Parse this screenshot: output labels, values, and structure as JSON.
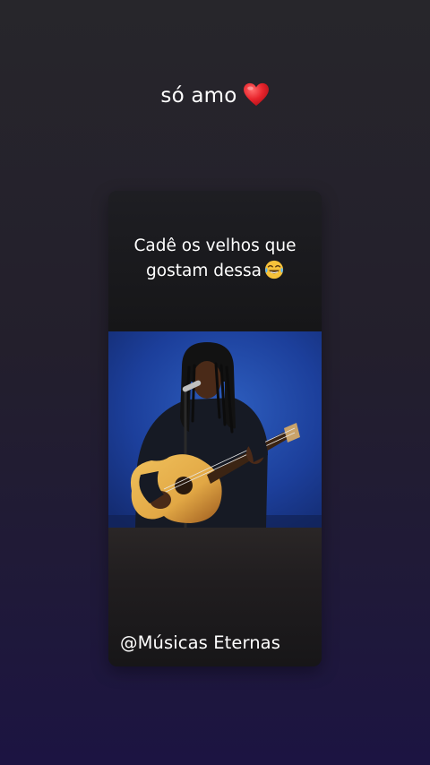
{
  "story": {
    "caption": "só amo",
    "caption_emoji": "red-heart-icon",
    "colors": {
      "background_top": "#27262b",
      "background_bottom": "#1c1442",
      "heart": "#e8242c"
    }
  },
  "post": {
    "question_line1": "Cadê os velhos que",
    "question_line2": "gostam dessa",
    "question_emoji": "tears-of-joy-icon",
    "video_description_icon": "guitarist-performance-thumbnail",
    "watermark": "@Músicas Eternas",
    "colors": {
      "video_background": "#1c3f9b",
      "guitar_body": "#e2a845"
    }
  }
}
